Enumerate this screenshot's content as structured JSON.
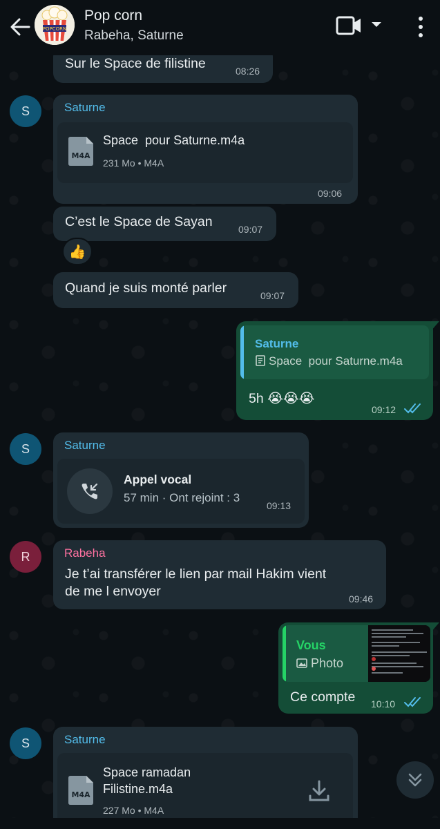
{
  "header": {
    "title": "Pop corn",
    "subtitle": "Rabeha, Saturne",
    "avatar_text": "POPCORN"
  },
  "colors": {
    "incoming_bubble": "#1f2c34",
    "outgoing_bubble": "#144d37",
    "saturne_name": "#53bdeb",
    "rabeha_name": "#ff72a1",
    "read_ticks": "#53bdeb"
  },
  "messages": [
    {
      "type": "text",
      "direction": "in",
      "text": "Sur le Space de filistine",
      "time": "08:26"
    },
    {
      "type": "file",
      "direction": "in",
      "sender": "Saturne",
      "avatar": "S",
      "icon_label": "M4A",
      "filename": "Space  pour Saturne.m4a",
      "size": "231 Mo",
      "ext": "M4A",
      "time": "09:06"
    },
    {
      "type": "text",
      "direction": "in",
      "text": "C’est le Space de Sayan",
      "time": "09:07",
      "reaction": "👍"
    },
    {
      "type": "text",
      "direction": "in",
      "text": "Quand je suis monté parler",
      "time": "09:07"
    },
    {
      "type": "reply",
      "direction": "out",
      "quote_sender": "Saturne",
      "quote_text": "Space  pour Saturne.m4a",
      "text": "5h 😭😭😭",
      "time": "09:12"
    },
    {
      "type": "call",
      "direction": "in",
      "sender": "Saturne",
      "avatar": "S",
      "call_title": "Appel vocal",
      "call_detail": "57 min · Ont rejoint : 3",
      "time": "09:13"
    },
    {
      "type": "text",
      "direction": "in",
      "sender": "Rabeha",
      "avatar": "R",
      "text_line1": "Je t’ai transférer le lien par mail Hakim vient",
      "text_line2": "de me l envoyer",
      "time": "09:46"
    },
    {
      "type": "reply",
      "direction": "out",
      "quote_sender": "Vous",
      "quote_text": "Photo",
      "text": "Ce compte",
      "time": "10:10"
    },
    {
      "type": "file",
      "direction": "in",
      "sender": "Saturne",
      "avatar": "S",
      "icon_label": "M4A",
      "filename_line1": "Space ramadan",
      "filename_line2": "Filistine.m4a",
      "size": "227 Mo",
      "ext": "M4A"
    }
  ]
}
